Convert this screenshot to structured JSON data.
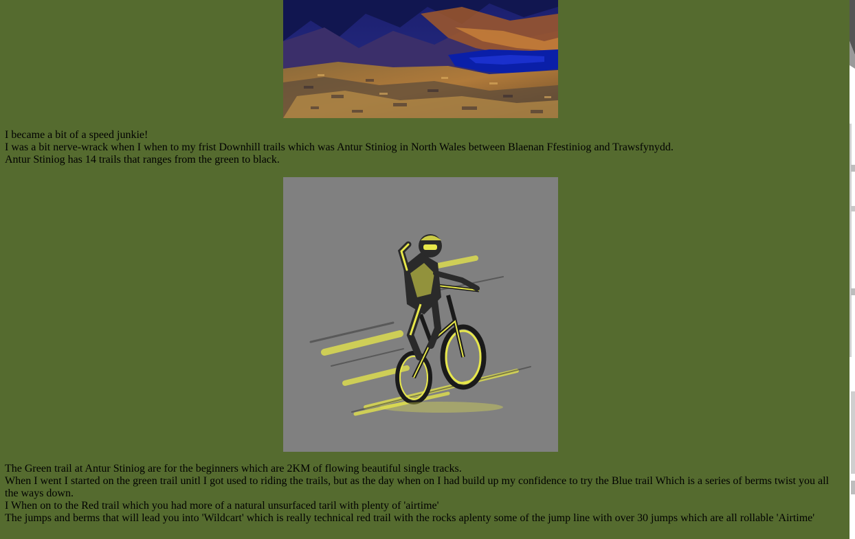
{
  "images": {
    "landscape": {
      "description_icon": "mountain-landscape-image"
    },
    "rider": {
      "description_icon": "downhill-mountain-bike-rider-image"
    }
  },
  "colors": {
    "background": "#556b2f",
    "rider_bg": "#808080",
    "rider_accent": "#e8e84a"
  },
  "block1": {
    "lines": [
      "I became a bit of a speed junkie!",
      "I was a bit nerve-wrack when I when to my frist Downhill trails which was Antur Stiniog in North Wales between Blaenan Ffestiniog and Trawsfynydd.",
      "Antur Stiniog has 14 trails that ranges from the green to black."
    ]
  },
  "block2": {
    "lines": [
      "The Green trail at Antur Stiniog are for the beginners which are 2KM of flowing beautiful single tracks.",
      "When I went I started on the green trail unitl I got used to riding the trails, but as the day when on I had build up my confidence to try the Blue trail Which is a series of berms twist you all the ways down.",
      "I When on to the Red trail which you had more of a natural unsurfaced taril with plenty of 'airtime'",
      "The jumps and berms that will lead you into 'Wildcart' which is really technical red trail with the rocks aplenty some of the jump line with over 30 jumps which are all rollable 'Airtime'"
    ]
  }
}
